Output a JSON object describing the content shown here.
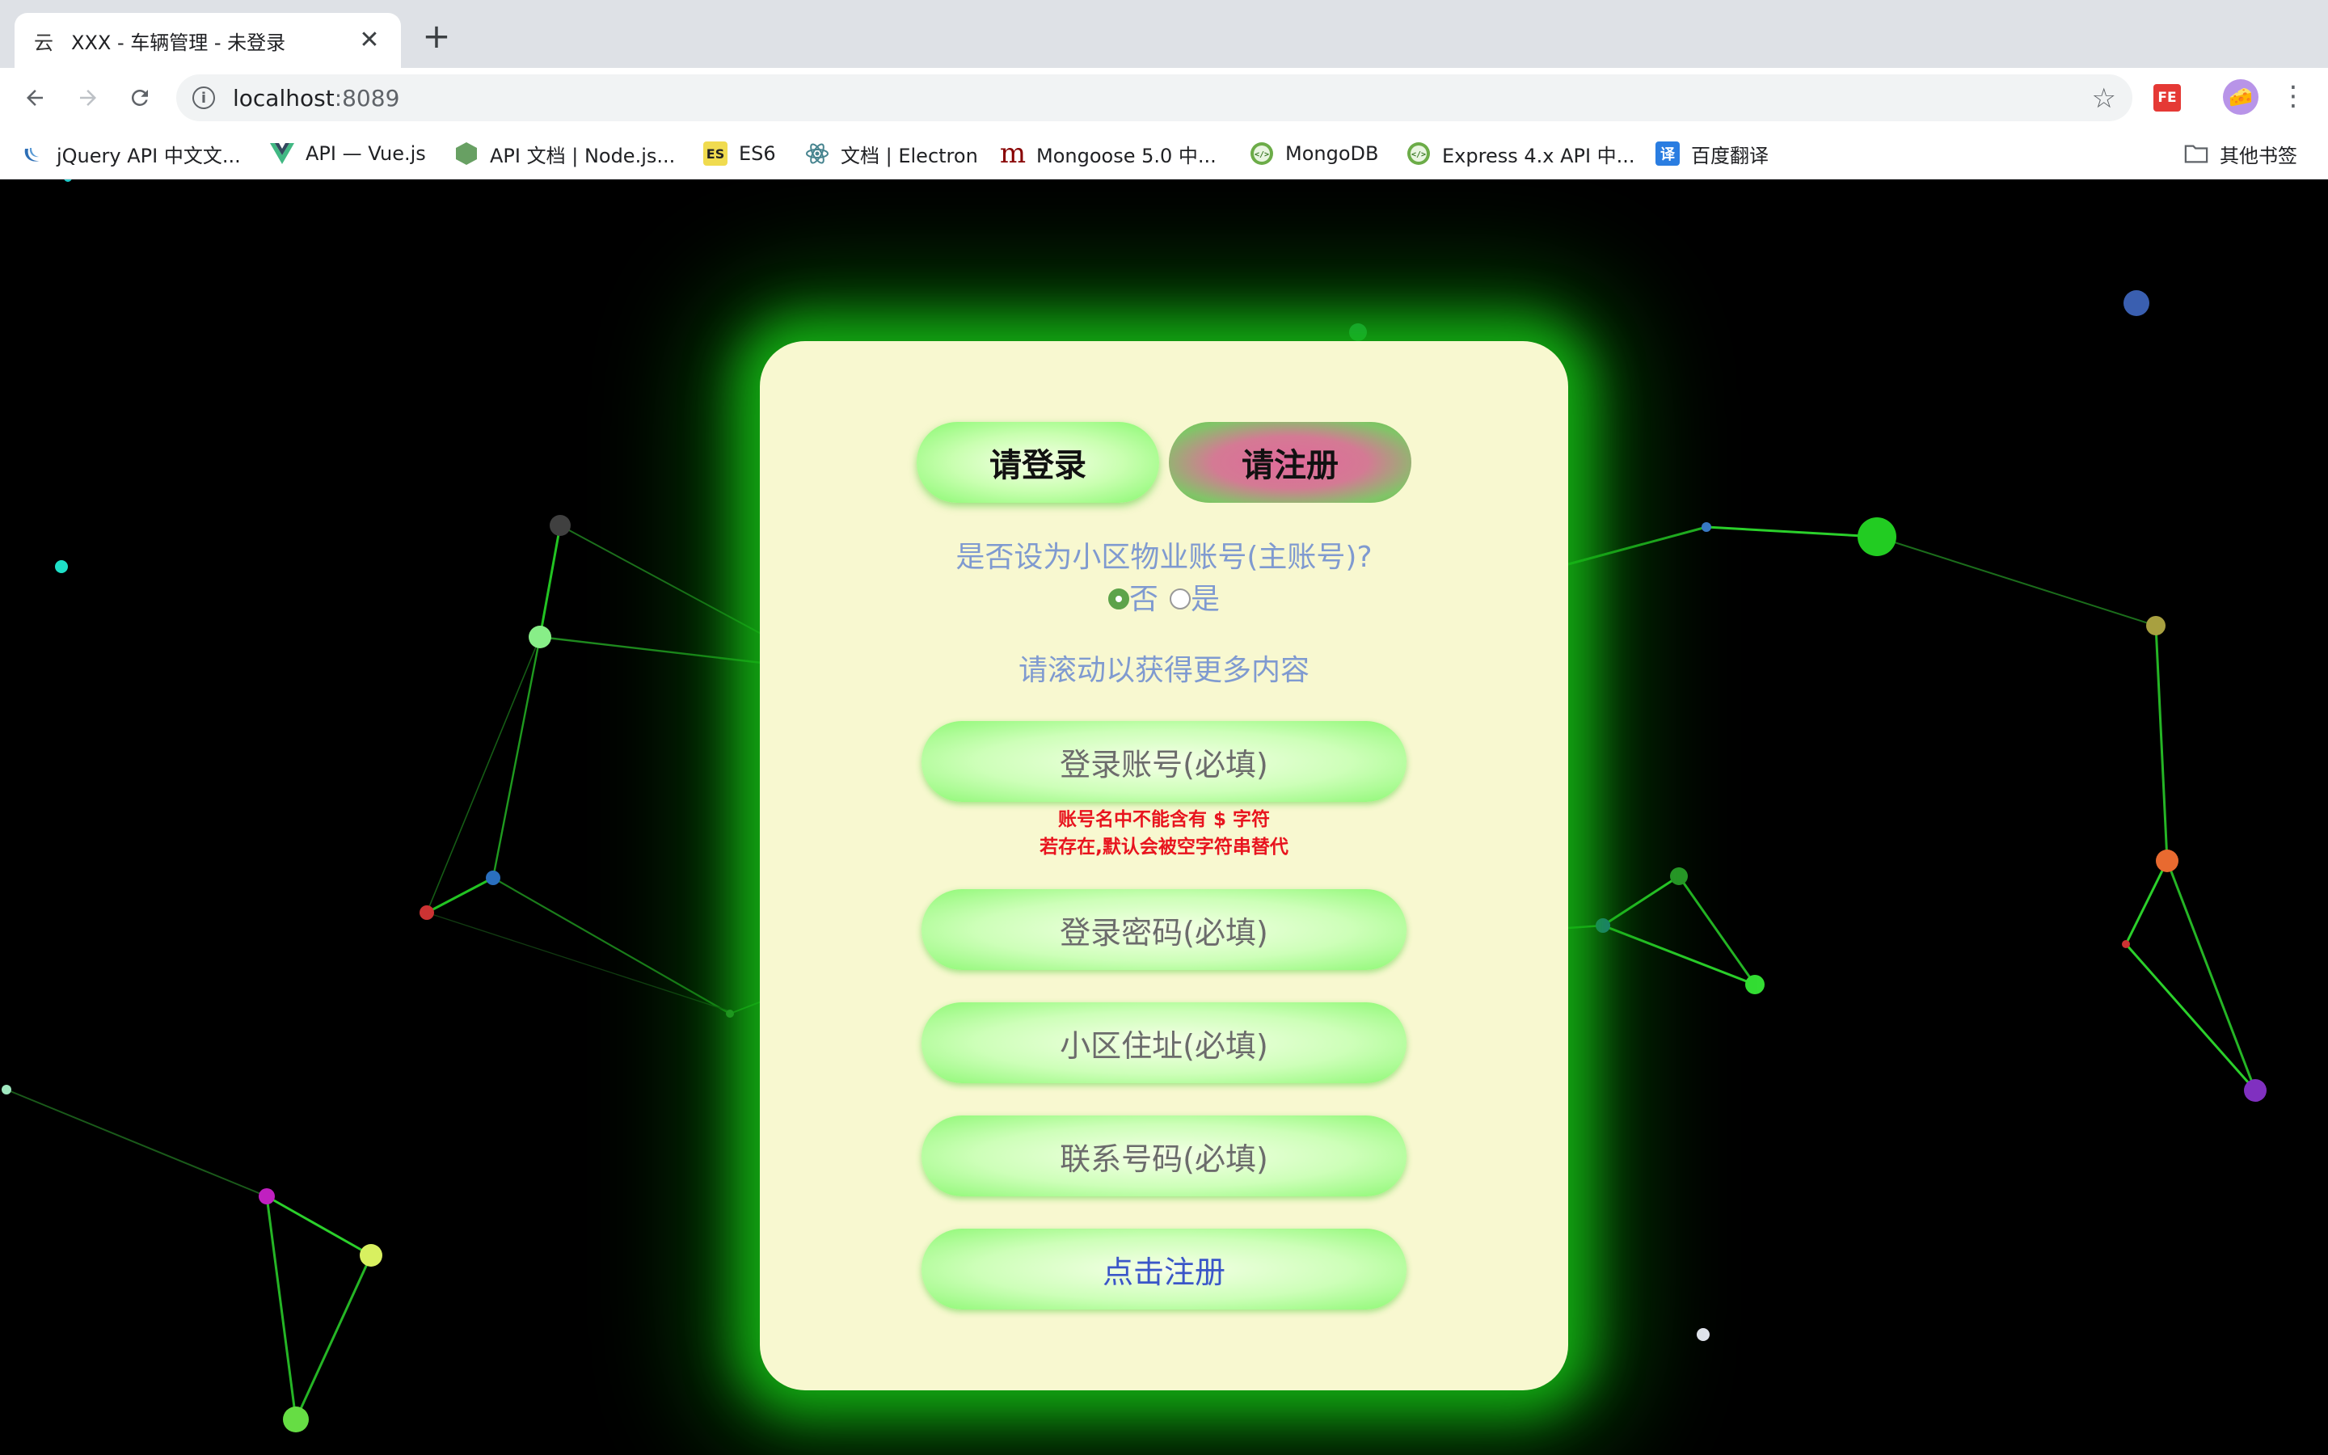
{
  "browser": {
    "tab_favicon": "云",
    "tab_title": "XXX - 车辆管理 - 未登录",
    "tab_close": "✕",
    "new_tab": "+",
    "url_host": "localhost",
    "url_port": ":8089",
    "extension_label": "FE",
    "bookmarks": [
      {
        "label": "jQuery API 中文文...",
        "icon": "jquery-icon",
        "color": "#2d6fb6"
      },
      {
        "label": "API — Vue.js",
        "icon": "vue-icon",
        "color": "#41b883"
      },
      {
        "label": "API 文档 | Node.js...",
        "icon": "nodejs-icon",
        "color": "#68a063"
      },
      {
        "label": "ES6",
        "icon": "es6-icon",
        "glyph": "ES",
        "color": "#f0db4f"
      },
      {
        "label": "文档 | Electron",
        "icon": "electron-icon",
        "color": "#47848f"
      },
      {
        "label": "Mongoose 5.0 中...",
        "icon": "mongoose-icon",
        "glyph": "m",
        "color": "#880000"
      },
      {
        "label": "MongoDB",
        "icon": "mongodb-icon",
        "color": "#6cac48"
      },
      {
        "label": "Express 4.x API 中...",
        "icon": "express-icon",
        "color": "#6cac48"
      },
      {
        "label": "百度翻译",
        "icon": "baidu-translate-icon",
        "glyph": "译",
        "color": "#2a7de1"
      }
    ],
    "other_bookmarks": "其他书签"
  },
  "form": {
    "login_tab": "请登录",
    "register_tab": "请注册",
    "question": "是否设为小区物业账号(主账号)?",
    "option_no": "否",
    "option_yes": "是",
    "selected_option": "否",
    "scroll_hint": "请滚动以获得更多内容",
    "account_placeholder": "登录账号(必填)",
    "warning_line1": "账号名中不能含有 $ 字符",
    "warning_line2": "若存在,默认会被空字符串替代",
    "password_placeholder": "登录密码(必填)",
    "address_placeholder": "小区住址(必填)",
    "phone_placeholder": "联系号码(必填)",
    "submit_label": "点击注册"
  },
  "colors": {
    "card_bg": "#f8f8d0",
    "glow": "#16be16",
    "hint_text": "#7f9ad0",
    "warning": "#e8141e",
    "submit_text": "#3a56c8"
  }
}
